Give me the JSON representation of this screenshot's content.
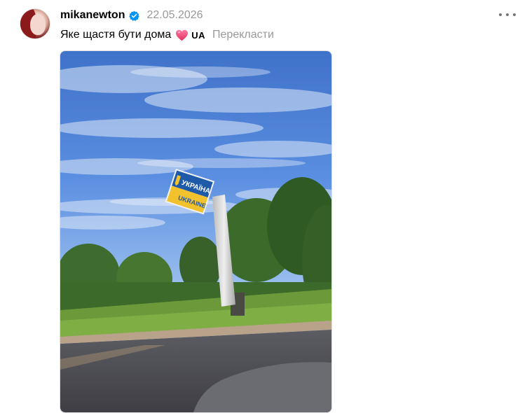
{
  "post": {
    "username": "mikanewton",
    "date": "22.05.2026",
    "caption": "Яке щастя бути дома",
    "flag_text": "UA",
    "translate_label": "Перекласти"
  },
  "sign": {
    "line1": "УКРАЇНА",
    "line2": "UKRAINE"
  },
  "icons": {
    "verified": "verified-badge-icon",
    "heart": "heart-emoji-icon",
    "more": "more-options-icon"
  },
  "colors": {
    "verified_blue": "#0095f6",
    "heart_pink": "#f0457a",
    "muted_text": "#999999"
  }
}
